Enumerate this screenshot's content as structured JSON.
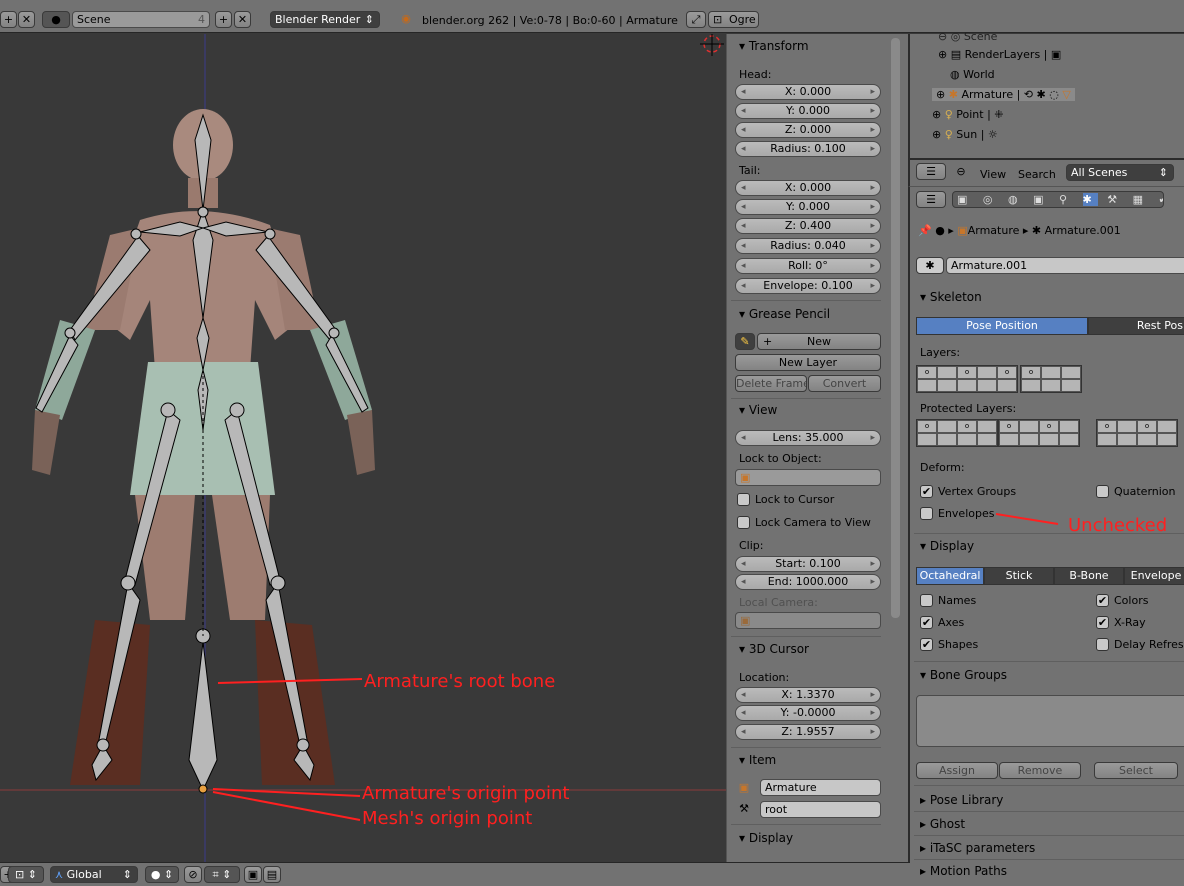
{
  "topbar": {
    "scene_name": "Scene",
    "scene_users": "4",
    "renderer": "Blender Render",
    "info": "blender.org 262 | Ve:0-78 | Bo:0-60 | Armature",
    "ogre_label": "Ogre"
  },
  "npanel": {
    "transform": {
      "title": "Transform",
      "head_label": "Head:",
      "head_x": "X: 0.000",
      "head_y": "Y: 0.000",
      "head_z": "Z: 0.000",
      "head_radius": "Radius: 0.100",
      "tail_label": "Tail:",
      "tail_x": "X: 0.000",
      "tail_y": "Y: 0.000",
      "tail_z": "Z: 0.400",
      "tail_radius": "Radius: 0.040",
      "roll": "Roll: 0°",
      "envelope": "Envelope: 0.100"
    },
    "grease": {
      "title": "Grease Pencil",
      "new": "New",
      "new_layer": "New Layer",
      "delete_frame": "Delete Frame",
      "convert": "Convert"
    },
    "view": {
      "title": "View",
      "lens": "Lens: 35.000",
      "lock_obj": "Lock to Object:",
      "lock_cursor": "Lock to Cursor",
      "lock_camera": "Lock Camera to View",
      "clip": "Clip:",
      "start": "Start: 0.100",
      "end": "End: 1000.000",
      "local_camera": "Local Camera:"
    },
    "cursor": {
      "title": "3D Cursor",
      "location": "Location:",
      "x": "X: 1.3370",
      "y": "Y: -0.0000",
      "z": "Z: 1.9557"
    },
    "item": {
      "title": "Item",
      "object": "Armature",
      "bone": "root"
    },
    "display": {
      "title": "Display"
    }
  },
  "outliner": {
    "items": [
      {
        "label": "Scene"
      },
      {
        "label": "RenderLayers"
      },
      {
        "label": "World"
      },
      {
        "label": "Armature"
      },
      {
        "label": "Point"
      },
      {
        "label": "Sun"
      }
    ],
    "view": "View",
    "search": "Search",
    "filter": "All Scenes"
  },
  "props": {
    "breadcrumb_obj": "Armature",
    "breadcrumb_data": "Armature.001",
    "datablock": "Armature.001",
    "skeleton": {
      "title": "Skeleton",
      "pose_position": "Pose Position",
      "rest_position": "Rest Pos",
      "layers": "Layers:",
      "protected": "Protected Layers:",
      "deform": "Deform:",
      "vertex_groups": "Vertex Groups",
      "quaternion": "Quaternion",
      "envelopes": "Envelopes"
    },
    "display": {
      "title": "Display",
      "octahedral": "Octahedral",
      "stick": "Stick",
      "bbone": "B-Bone",
      "envelope": "Envelope",
      "names": "Names",
      "colors": "Colors",
      "axes": "Axes",
      "xray": "X-Ray",
      "shapes": "Shapes",
      "delay": "Delay Refresh"
    },
    "bone_groups": {
      "title": "Bone Groups",
      "assign": "Assign",
      "remove": "Remove",
      "select": "Select"
    },
    "pose_library": "Pose Library",
    "ghost": "Ghost",
    "itasc": "iTaSC parameters",
    "motion_paths": "Motion Paths"
  },
  "bottombar": {
    "orientation": "Global"
  },
  "annotations": {
    "root_bone": "Armature's root bone",
    "arm_origin": "Armature's origin point",
    "mesh_origin": "Mesh's origin point",
    "unchecked": "Unchecked"
  }
}
